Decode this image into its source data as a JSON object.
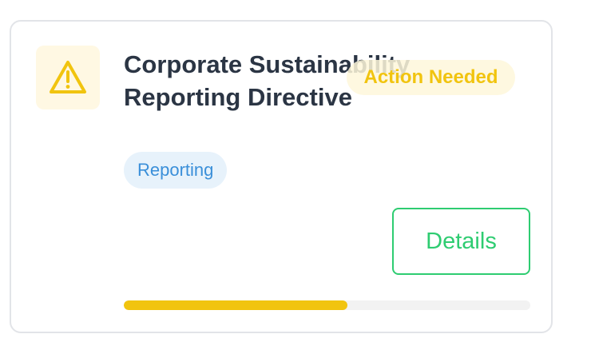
{
  "card": {
    "title": "Corporate Sustainability Reporting Directive",
    "status": "Action Needed",
    "tag": "Reporting",
    "details_label": "Details",
    "icon": "warning-triangle-icon",
    "progress_percent": 55
  },
  "colors": {
    "warning": "#f1c40f",
    "warning_tile_bg": "#fff8e3",
    "tag_text": "#3a8fd9",
    "tag_bg": "#e7f2fb",
    "button_accent": "#2ecc71",
    "title_text": "#2b3544",
    "progress_track": "#f2f2f2"
  }
}
